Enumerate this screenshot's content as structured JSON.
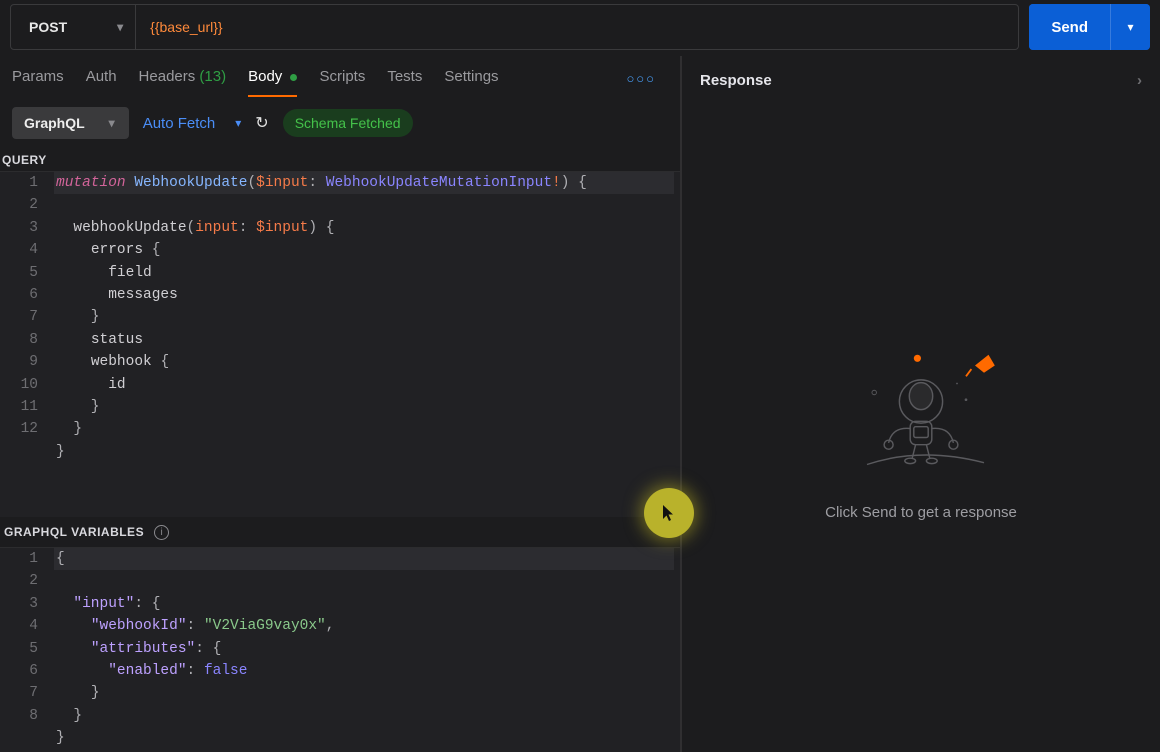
{
  "request": {
    "method": "POST",
    "url": "{{base_url}}",
    "send_label": "Send"
  },
  "tabs": {
    "params": "Params",
    "auth": "Auth",
    "headers": "Headers",
    "headers_count": "(13)",
    "body": "Body",
    "scripts": "Scripts",
    "tests": "Tests",
    "settings": "Settings"
  },
  "toolbar": {
    "mode": "GraphQL",
    "autofetch": "Auto Fetch",
    "schema_badge": "Schema Fetched"
  },
  "query_label": "QUERY",
  "variables_label": "GRAPHQL VARIABLES",
  "query_lines": {
    "l1": "mutation WebhookUpdate($input: WebhookUpdateMutationInput!) {",
    "l2": "  webhookUpdate(input: $input) {",
    "l3": "    errors {",
    "l4": "      field",
    "l5": "      messages",
    "l6": "    }",
    "l7": "    status",
    "l8": "    webhook {",
    "l9": "      id",
    "l10": "    }",
    "l11": "  }",
    "l12": "}"
  },
  "query_line_numbers": [
    "1",
    "2",
    "3",
    "4",
    "5",
    "6",
    "7",
    "8",
    "9",
    "10",
    "11",
    "12"
  ],
  "variables_lines": {
    "l1": "{",
    "l2": "  \"input\": {",
    "l3": "    \"webhookId\": \"V2ViaG9vay0x\",",
    "l4": "    \"attributes\": {",
    "l5": "      \"enabled\": false",
    "l6": "    }",
    "l7": "  }",
    "l8": "}"
  },
  "variables_line_numbers": [
    "1",
    "2",
    "3",
    "4",
    "5",
    "6",
    "7",
    "8"
  ],
  "response": {
    "title": "Response",
    "empty_msg": "Click Send to get a response"
  }
}
